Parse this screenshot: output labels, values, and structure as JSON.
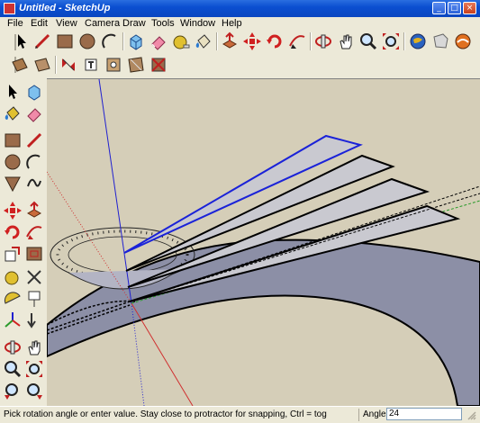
{
  "window": {
    "title": "Untitled - SketchUp"
  },
  "title_buttons": {
    "minimize": "_",
    "maximize": "□",
    "close": "×"
  },
  "menus": [
    "File",
    "Edit",
    "View",
    "Camera",
    "Draw",
    "Tools",
    "Window",
    "Help"
  ],
  "toolbar_top": [
    "select-icon",
    "line-icon",
    "rectangle-icon",
    "circle-icon",
    "arc-icon",
    "make-component-icon",
    "eraser-icon",
    "tape-measure-icon",
    "paint-bucket-icon",
    "push-pull-icon",
    "move-icon",
    "rotate-icon",
    "follow-me-icon",
    "orbit-icon",
    "pan-icon",
    "zoom-icon",
    "zoom-extents-icon",
    "get-models-icon",
    "share-model-icon",
    "components-icon"
  ],
  "toolbar_second": [
    "section-plane-icon",
    "section-cut-icon",
    "dimension-icon",
    "text-icon",
    "axes-icon",
    "3d-text-icon",
    "paint-icon"
  ],
  "left_toolbar": [
    "select-icon",
    "make-component-icon",
    "paint-bucket-icon",
    "eraser-icon",
    "rectangle-icon",
    "line-icon",
    "circle-icon",
    "arc-icon",
    "polygon-icon",
    "freehand-icon",
    "move-icon",
    "push-pull-icon",
    "rotate-icon",
    "follow-me-icon",
    "scale-icon",
    "offset-icon",
    "tape-measure-icon",
    "dimension-icon",
    "protractor-icon",
    "text-icon",
    "axes-icon",
    "3d-text-icon",
    "orbit-icon",
    "pan-icon",
    "zoom-icon",
    "zoom-window-icon",
    "previous-view-icon",
    "next-view-icon"
  ],
  "status": {
    "message": "Pick rotation angle or enter value.  Stay close to protractor for snapping, Ctrl = tog",
    "vcb_label": "Angle",
    "vcb_value": "24"
  },
  "colors": {
    "title_bar": "#0b4fd1",
    "viewport_background": "#d5ceb8",
    "face_color": "#8c8fa6",
    "fin_fill": "#c9c9d0",
    "selected_edge": "#1a22d8",
    "red_axis": "#d03030",
    "green_axis": "#2a9a2a",
    "blue_axis": "#2020d0"
  }
}
